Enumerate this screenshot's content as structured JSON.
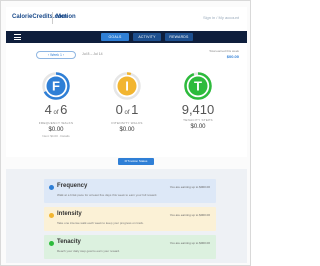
{
  "header": {
    "brand": "CalorieCredits.com",
    "product": "Motion",
    "top_link": "Sign in / My account"
  },
  "nav": {
    "tabs": [
      {
        "label": "Goals",
        "active": true
      },
      {
        "label": "Activity",
        "active": false
      },
      {
        "label": "Rewards",
        "active": false
      }
    ]
  },
  "controls": {
    "week_pill": "‹  Week 1  ›",
    "date_range": "Jul 8 – Jul 14",
    "total_label": "Total earned this week",
    "total_value": "$00.00"
  },
  "stats": [
    {
      "letter": "F",
      "value": "4",
      "of": "of",
      "max": "6",
      "caption": "Frequency walks",
      "money": "$0.00",
      "sub": "Next: $4.00 · Details",
      "color": "#2f7fd6",
      "progress": 0.67
    },
    {
      "letter": "I",
      "value": "0",
      "of": "of",
      "max": "1",
      "caption": "Intensity walks",
      "money": "$0.00",
      "sub": "",
      "color": "#f2b530",
      "progress": 0.05
    },
    {
      "letter": "T",
      "value": "9,410",
      "of": "",
      "max": "",
      "caption": "Tenacity steps",
      "money": "$0.00",
      "sub": "",
      "color": "#2dbb3c",
      "progress": 0.94
    }
  ],
  "cta_label": "FITmotion Status",
  "cards": [
    {
      "title": "Frequency",
      "earn": "You are earning up to $000.00",
      "desc": "Walk at a brisk pace for at least five days this week to earn your full reward.",
      "color": "#2f7fd6",
      "bg": "#dde8f7"
    },
    {
      "title": "Intensity",
      "earn": "You are earning up to $000.00",
      "desc": "Take one intense walk each week to keep your progress on track.",
      "color": "#f2b530",
      "bg": "#fbf1d6"
    },
    {
      "title": "Tenacity",
      "earn": "You are earning up to $000.00",
      "desc": "Reach your daily step goal to earn your reward.",
      "color": "#2dbb3c",
      "bg": "#dcf1df"
    }
  ]
}
